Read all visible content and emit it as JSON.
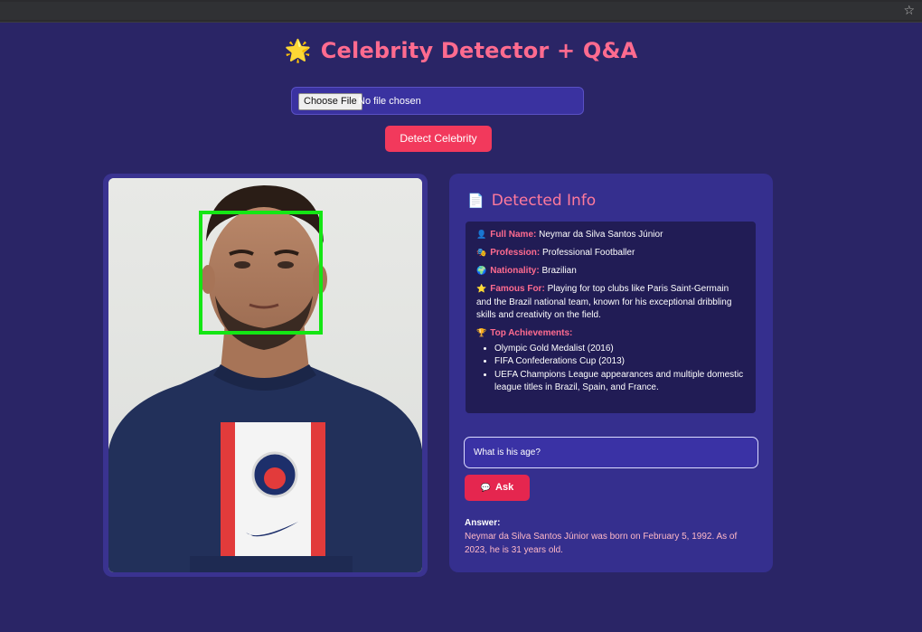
{
  "browser": {
    "bookmark_icon": "star-icon"
  },
  "header": {
    "icon": "🌟",
    "title": "Celebrity Detector + Q&A"
  },
  "upload": {
    "choose_label": "Choose File",
    "status": "No file chosen"
  },
  "detect_button": "Detect Celebrity",
  "photo": {
    "face_box_color": "#14e614"
  },
  "info": {
    "heading_icon": "📄",
    "heading": "Detected Info",
    "full_name_label": "Full Name:",
    "full_name": "Neymar da Silva Santos Júnior",
    "profession_label": "Profession:",
    "profession": "Professional Footballer",
    "nationality_label": "Nationality:",
    "nationality": "Brazilian",
    "famous_label": "Famous For:",
    "famous": "Playing for top clubs like Paris Saint-Germain and the Brazil national team, known for his exceptional dribbling skills and creativity on the field.",
    "achievements_label": "Top Achievements:",
    "achievements": [
      "Olympic Gold Medalist (2016)",
      "FIFA Confederations Cup (2013)",
      "UEFA Champions League appearances and multiple domestic league titles in Brazil, Spain, and France."
    ]
  },
  "qa": {
    "question_value": "What is his age?",
    "ask_label": "Ask",
    "answer_label": "Answer:",
    "answer": "Neymar da Silva Santos Júnior was born on February 5, 1992. As of 2023, he is 31 years old."
  },
  "colors": {
    "background": "#2a2566",
    "accent": "#ff6b8f",
    "button": "#f2395c"
  }
}
